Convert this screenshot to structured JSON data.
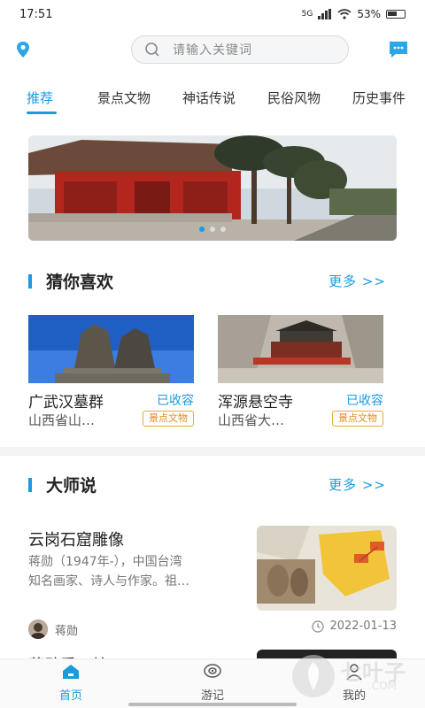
{
  "status": {
    "time": "17:51",
    "network": "5G",
    "battery": "53%"
  },
  "search": {
    "placeholder": "请输入关键词"
  },
  "tabs": [
    {
      "label": "推荐",
      "active": true
    },
    {
      "label": "景点文物"
    },
    {
      "label": "神话传说"
    },
    {
      "label": "民俗风物"
    },
    {
      "label": "历史事件"
    }
  ],
  "section_guess": {
    "title": "猜你喜欢",
    "more": "更多 >>"
  },
  "cards": [
    {
      "name": "广武汉墓群",
      "saved": "已收容",
      "address": "山西省山…",
      "tag": "景点文物"
    },
    {
      "name": "浑源悬空寺",
      "saved": "已收容",
      "address": "山西省大…",
      "tag": "景点文物"
    }
  ],
  "section_master": {
    "title": "大师说",
    "more": "更多 >>"
  },
  "article": {
    "title": "云岗石窟雕像",
    "desc_line1": "蒋勋（1947年-），中国台湾",
    "desc_line2": "知名画家、诗人与作家。祖…",
    "author": "蒋勋",
    "date": "2022-01-13"
  },
  "next_article_peek": "蒋勋看石棺",
  "bottom_nav": [
    {
      "label": "首页",
      "icon": "home-icon",
      "active": true
    },
    {
      "label": "游记",
      "icon": "travel-notes-icon"
    },
    {
      "label": "我的",
      "icon": "profile-icon"
    }
  ],
  "watermark": {
    "text": "七叶子",
    "sub": ".COM"
  },
  "colors": {
    "accent": "#1a9be0",
    "tag": "#e08a1a"
  }
}
